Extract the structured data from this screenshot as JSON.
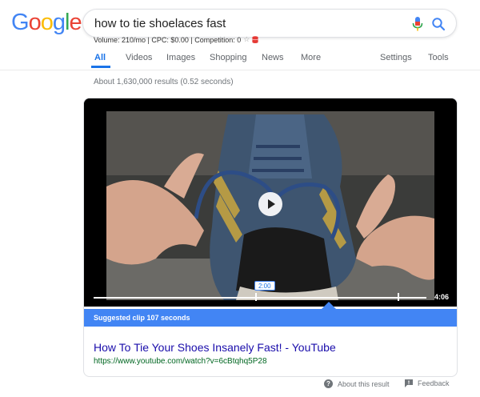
{
  "logo": {
    "text": "Google",
    "colors": [
      "#4285f4",
      "#ea4335",
      "#fbbc05",
      "#4285f4",
      "#34a853",
      "#ea4335"
    ]
  },
  "search": {
    "query": "how to tie shoelaces fast"
  },
  "keyword_bar": {
    "text": "Volume: 210/mo | CPC: $0.00 | Competition: 0"
  },
  "tabs": [
    {
      "label": "All",
      "active": true
    },
    {
      "label": "Videos"
    },
    {
      "label": "Images"
    },
    {
      "label": "Shopping"
    },
    {
      "label": "News"
    },
    {
      "label": "More"
    },
    {
      "label": "Settings"
    },
    {
      "label": "Tools"
    }
  ],
  "results_stats": "About 1,630,000 results (0.52 seconds)",
  "video": {
    "clip_start_label": "2:00",
    "duration": "4:06",
    "suggested_clip": "Suggested clip 107 seconds"
  },
  "result": {
    "title": "How To Tie Your Shoes Insanely Fast! - YouTube",
    "url": "https://www.youtube.com/watch?v=6cBtqhq5P28"
  },
  "footer": {
    "about": "About this result",
    "feedback": "Feedback"
  },
  "colors": {
    "accent": "#1a73e8",
    "banner": "#4285f4",
    "link": "#1a0dab",
    "url": "#006621"
  }
}
